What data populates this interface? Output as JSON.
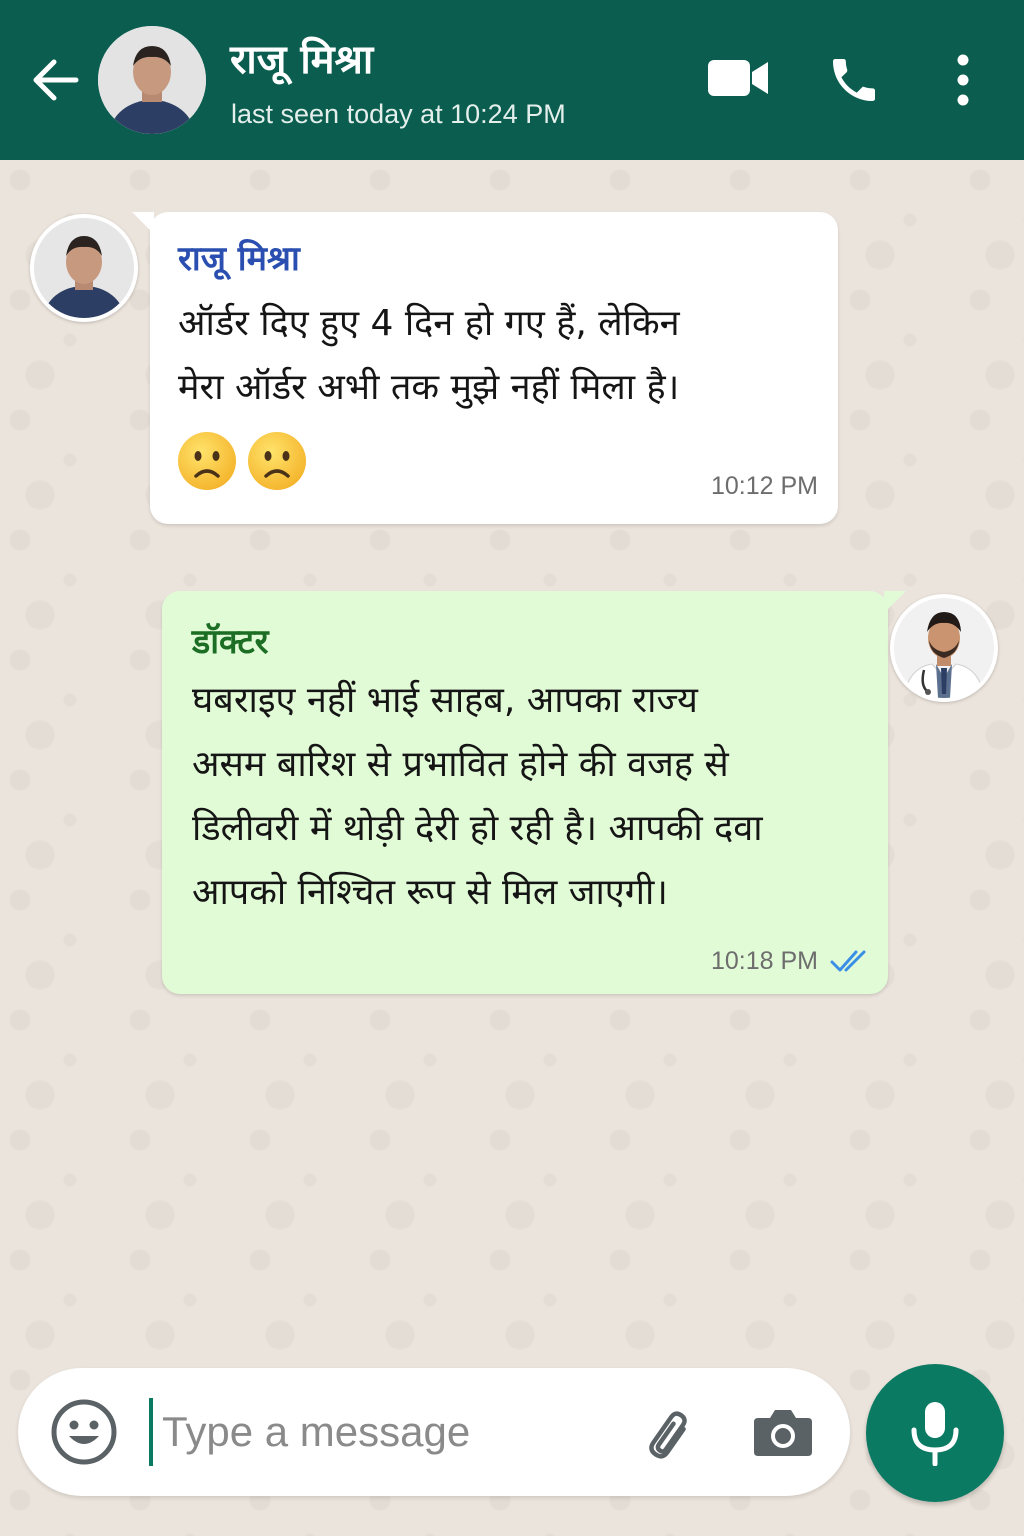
{
  "header": {
    "contact_name": "राजू मिश्रा",
    "last_seen": "last seen today at 10:24 PM",
    "back_icon": "arrow-left-icon",
    "video_icon": "video-camera-icon",
    "call_icon": "phone-icon",
    "menu_icon": "more-vertical-icon",
    "bg_color": "#0b5e4f"
  },
  "messages": [
    {
      "direction": "incoming",
      "sender": "राजू मिश्रा",
      "lines": [
        "ऑर्डर दिए हुए 4 दिन हो गए हैं, लेकिन",
        "मेरा ऑर्डर अभी तक मुझे नहीं मिला है।"
      ],
      "emojis": [
        "sad-face-emoji",
        "sad-face-emoji"
      ],
      "time": "10:12 PM",
      "bubble_color": "#ffffff"
    },
    {
      "direction": "outgoing",
      "sender": "डॉक्टर",
      "lines": [
        "घबराइए नहीं भाई साहब, आपका राज्य",
        "असम बारिश से प्रभावित होने की वजह से",
        "डिलीवरी में थोड़ी देरी हो रही है। आपकी दवा",
        "आपको निश्चित रूप से मिल जाएगी।"
      ],
      "time": "10:18 PM",
      "status": "read",
      "status_icon": "double-check-icon",
      "bubble_color": "#e2fbd7"
    }
  ],
  "composer": {
    "placeholder": "Type a message",
    "value": "",
    "emoji_icon": "smiley-icon",
    "attach_icon": "paperclip-icon",
    "camera_icon": "camera-icon",
    "mic_icon": "microphone-icon",
    "accent_color": "#0b7a63"
  }
}
